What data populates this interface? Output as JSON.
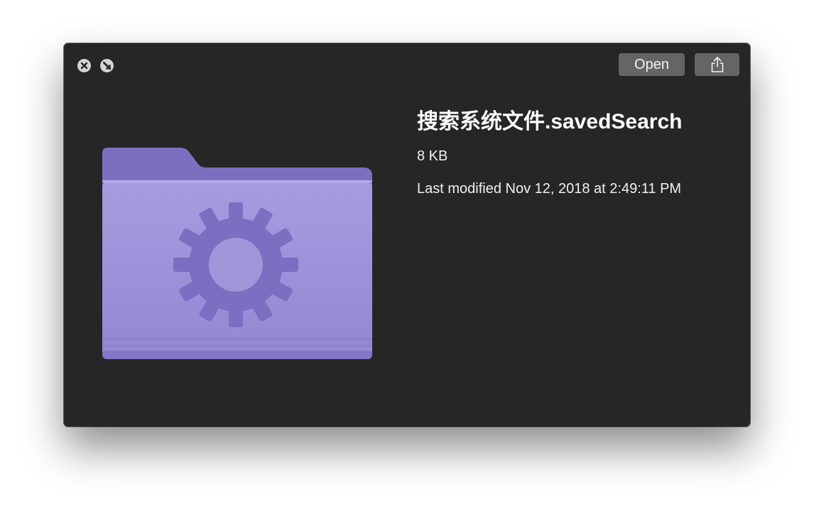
{
  "window": {
    "title_buttons": {
      "close_icon": "close-circle-icon",
      "fullscreen_icon": "fullscreen-circle-icon"
    },
    "toolbar": {
      "open_label": "Open",
      "share_icon": "share-icon"
    }
  },
  "preview": {
    "icon": "purple-folder-gear-icon",
    "file_name": "搜索系统文件.savedSearch",
    "file_size": "8 KB",
    "modified": "Last modified Nov 12, 2018 at 2:49:11 PM"
  },
  "colors": {
    "window_background": "#262626",
    "button_background": "#656565",
    "folder_purple": "#9b8ed6",
    "folder_gear": "#7c6fc2"
  }
}
